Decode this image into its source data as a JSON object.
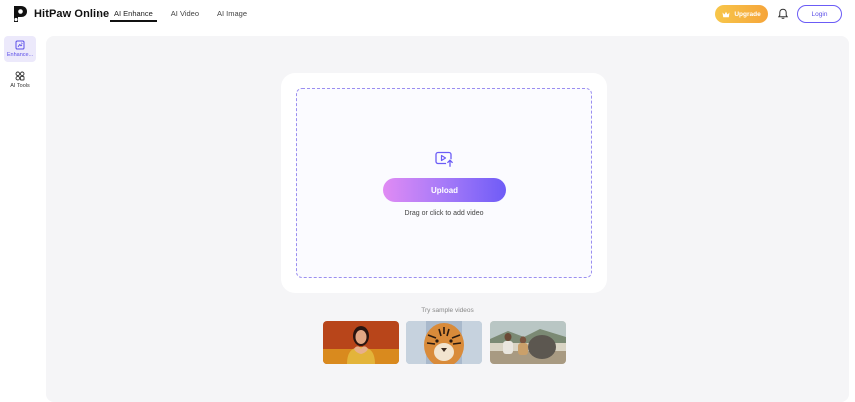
{
  "header": {
    "brand": "HitPaw Online",
    "nav": [
      {
        "label": "AI Enhance",
        "active": true
      },
      {
        "label": "AI Video",
        "active": false
      },
      {
        "label": "AI Image",
        "active": false
      }
    ],
    "upgrade_label": "Upgrade",
    "login_label": "Login"
  },
  "sidebar": {
    "items": [
      {
        "label": "Enhance...",
        "icon": "enhance-icon",
        "active": true
      },
      {
        "label": "AI Tools",
        "icon": "tools-icon",
        "active": false
      }
    ]
  },
  "upload": {
    "button_label": "Upload",
    "hint": "Drag or click to add video"
  },
  "samples": {
    "label": "Try sample videos",
    "items": [
      "woman-heart-hands-thumbnail",
      "tiger-thumbnail",
      "two-men-outdoors-thumbnail"
    ]
  },
  "colors": {
    "accent": "#6b5cf6",
    "upgrade_start": "#f7c64a",
    "upgrade_end": "#f6a53a",
    "upload_start": "#e08bf4",
    "upload_end": "#6f5cf7",
    "main_bg": "#f5f5f7"
  }
}
